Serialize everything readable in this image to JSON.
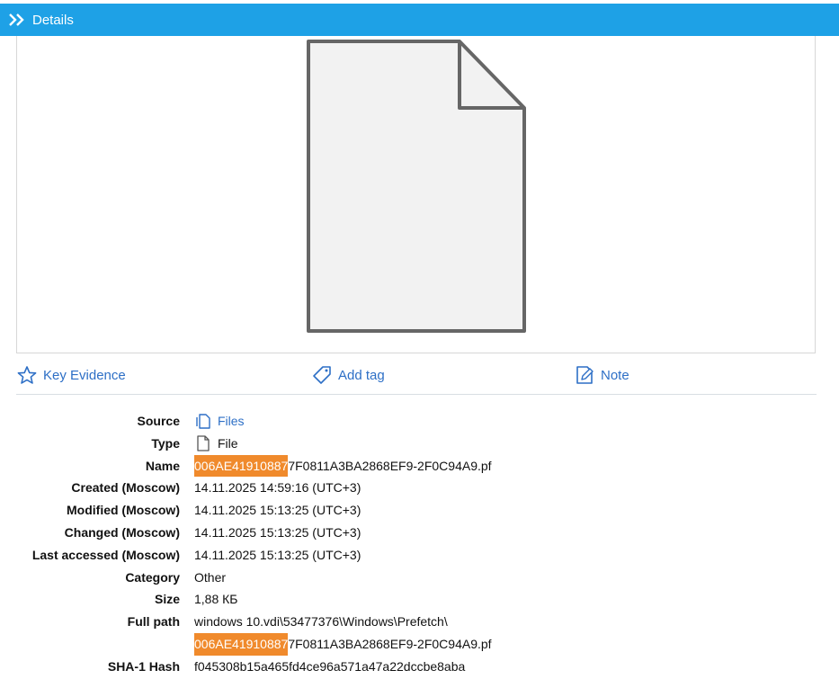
{
  "header": {
    "title": "Details"
  },
  "actions": {
    "key_evidence": "Key Evidence",
    "add_tag": "Add tag",
    "note": "Note"
  },
  "properties": [
    {
      "label": "Source",
      "value": "Files"
    },
    {
      "label": "Type",
      "value": "File"
    },
    {
      "label": "Name",
      "value_highlight": "006AE41910887",
      "value_rest": "7F0811A3BA2868EF9-2F0C94A9.pf"
    },
    {
      "label": "Created (Moscow)",
      "value": "14.11.2025 14:59:16 (UTC+3)"
    },
    {
      "label": "Modified (Moscow)",
      "value": "14.11.2025 15:13:25 (UTC+3)"
    },
    {
      "label": "Changed (Moscow)",
      "value": "14.11.2025 15:13:25 (UTC+3)"
    },
    {
      "label": "Last accessed (Moscow)",
      "value": "14.11.2025 15:13:25 (UTC+3)"
    },
    {
      "label": "Category",
      "value": "Other"
    },
    {
      "label": "Size",
      "value": "1,88 КБ"
    },
    {
      "label": "Full path",
      "value": "windows 10.vdi\\53477376\\Windows\\Prefetch\\",
      "value2_highlight": "006AE41910887",
      "value2_rest": "7F0811A3BA2868EF9-2F0C94A9.pf"
    },
    {
      "label": "SHA-1 Hash",
      "value": "f045308b15a465fd4ce96a571a47a22dccbe8aba"
    }
  ],
  "colors": {
    "header_bg": "#1ea1e6",
    "link": "#2d6fc6",
    "highlight": "#f08a2c"
  }
}
